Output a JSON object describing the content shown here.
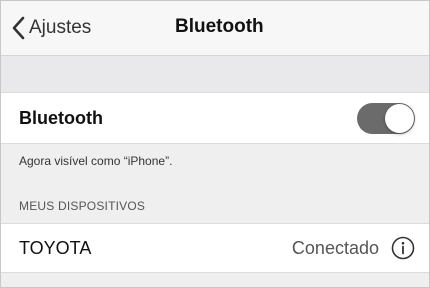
{
  "navbar": {
    "back_label": "Ajustes",
    "title": "Bluetooth",
    "back_icon": "chevron-left-icon"
  },
  "bluetooth": {
    "label": "Bluetooth",
    "toggle_on": true,
    "footnote": "Agora visível como “iPhone”."
  },
  "devices": {
    "section_header": "MEUS DISPOSITIVOS",
    "items": [
      {
        "name": "TOYOTA",
        "status": "Conectado",
        "info_icon": "info-icon"
      }
    ]
  },
  "colors": {
    "toggle_track": "#6b6b6b",
    "background": "#efeff0"
  }
}
